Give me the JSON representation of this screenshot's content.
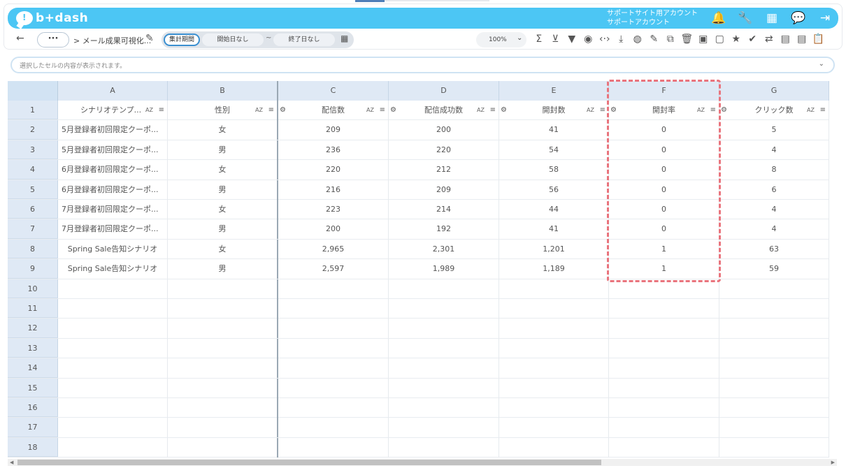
{
  "app": {
    "logo_text": "b+dash",
    "account_line1": "サポートサイト用アカウント",
    "account_line2": "サポートアカウント"
  },
  "top_icons": [
    {
      "name": "bell-icon",
      "glyph": "🔔"
    },
    {
      "name": "wrench-icon",
      "glyph": "🔧"
    },
    {
      "name": "apps-grid-icon",
      "glyph": "▦"
    },
    {
      "name": "chat-icon",
      "glyph": "💬"
    },
    {
      "name": "logout-icon",
      "glyph": "⇥"
    }
  ],
  "toolbar": {
    "back_glyph": "←",
    "more_label": "···",
    "breadcrumb": "> メール成果可視化...",
    "period_label": "集計期間",
    "start_date": "開始日なし",
    "tilde": "~",
    "end_date": "終了日なし",
    "zoom": "100%",
    "tools": [
      {
        "name": "sum-icon",
        "glyph": "Σ"
      },
      {
        "name": "filter-clear-icon",
        "glyph": "⊻"
      },
      {
        "name": "filter-icon",
        "glyph": "▼"
      },
      {
        "name": "eye-icon",
        "glyph": "◉"
      },
      {
        "name": "code-icon",
        "glyph": "‹·›"
      },
      {
        "name": "download-icon",
        "glyph": "⤓"
      },
      {
        "name": "chart-icon",
        "glyph": "◍"
      },
      {
        "name": "edit-note-icon",
        "glyph": "✎"
      },
      {
        "name": "copy-icon",
        "glyph": "⧉"
      },
      {
        "name": "trash-icon",
        "glyph": "🗑"
      },
      {
        "name": "archive-icon",
        "glyph": "▣"
      },
      {
        "name": "archive-disabled-icon",
        "glyph": "▢"
      },
      {
        "name": "star-icon",
        "glyph": "★"
      },
      {
        "name": "user-check-icon",
        "glyph": "✔"
      },
      {
        "name": "repeat-icon",
        "glyph": "⇄"
      },
      {
        "name": "calendar-icon",
        "glyph": "▤"
      },
      {
        "name": "document-icon",
        "glyph": "▤"
      },
      {
        "name": "clipboard-icon",
        "glyph": "📋"
      }
    ]
  },
  "formula": {
    "placeholder": "選択したセルの内容が表示されます。"
  },
  "sheet": {
    "columns": [
      "A",
      "B",
      "C",
      "D",
      "E",
      "F",
      "G"
    ],
    "headers": [
      "シナリオテンプ...",
      "性別",
      "配信数",
      "配信成功数",
      "開封数",
      "開封率",
      "クリック数"
    ],
    "sort_label": "AZ",
    "filter_glyph": "≡",
    "gear_glyph": "⚙",
    "rows": [
      [
        "5月登録者初回限定クーポ...",
        "女",
        "209",
        "200",
        "41",
        "0",
        "5"
      ],
      [
        "5月登録者初回限定クーポ...",
        "男",
        "236",
        "220",
        "54",
        "0",
        "4"
      ],
      [
        "6月登録者初回限定クーポ...",
        "女",
        "220",
        "212",
        "58",
        "0",
        "8"
      ],
      [
        "6月登録者初回限定クーポ...",
        "男",
        "216",
        "209",
        "56",
        "0",
        "6"
      ],
      [
        "7月登録者初回限定クーポ...",
        "女",
        "223",
        "214",
        "44",
        "0",
        "4"
      ],
      [
        "7月登録者初回限定クーポ...",
        "男",
        "200",
        "192",
        "41",
        "0",
        "4"
      ],
      [
        "Spring Sale告知シナリオ",
        "女",
        "2,965",
        "2,301",
        "1,201",
        "1",
        "63"
      ],
      [
        "Spring Sale告知シナリオ",
        "男",
        "2,597",
        "1,989",
        "1,189",
        "1",
        "59"
      ]
    ],
    "row_numbers": [
      "1",
      "2",
      "3",
      "4",
      "5",
      "6",
      "7",
      "8",
      "9",
      "10",
      "11",
      "12",
      "13",
      "14",
      "15",
      "16",
      "17",
      "18"
    ]
  },
  "colors": {
    "brand": "#4cc6f4",
    "highlight": "#e9747d",
    "header_bg": "#dfe9f5"
  }
}
